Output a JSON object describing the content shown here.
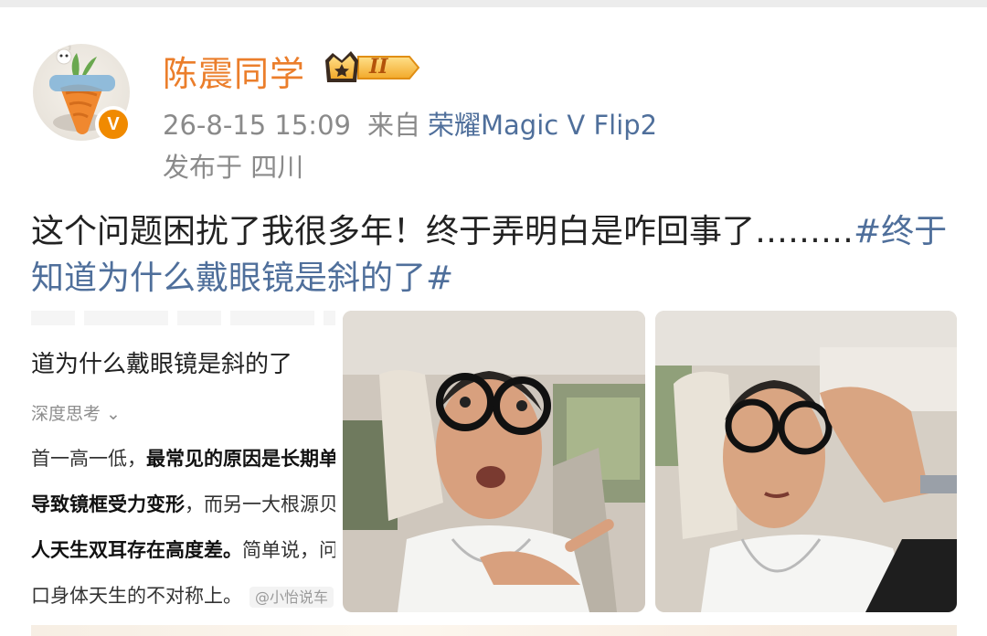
{
  "user": {
    "name": "陈震同学",
    "vip_level": "II",
    "verified_mark": "V"
  },
  "post_meta": {
    "time": "26-8-15 15:09",
    "source_prefix": "来自",
    "device": "荣耀Magic V Flip2",
    "location": "发布于 四川"
  },
  "post": {
    "text": "这个问题困扰了我很多年！终于弄明白是咋回事了………",
    "hashtag": "#终于知道为什么戴眼镜是斜的了#"
  },
  "article_image": {
    "title": "道为什么戴眼镜是斜的了",
    "subtitle": "深度思考 ⌄",
    "line1_plain": "首一高一低，",
    "line1_bold": "最常见的原因是长期单",
    "line2_bold": "导致镜框受力变形",
    "line2_plain": "，而另一大根源贝",
    "line3_bold": "人天生双耳存在高度差。",
    "line3_plain": "简单说，问",
    "line4_plain": "口身体天生的不对称上。",
    "watermark": "@小怡说车"
  },
  "icons": [
    "avatar-carrot-icon",
    "verified-icon",
    "vip-crown-icon"
  ],
  "colors": {
    "username": "#eb7e2b",
    "link": "#4f6f9b",
    "meta": "#8a8a8a",
    "text": "#222222",
    "verified": "#f08a00"
  }
}
